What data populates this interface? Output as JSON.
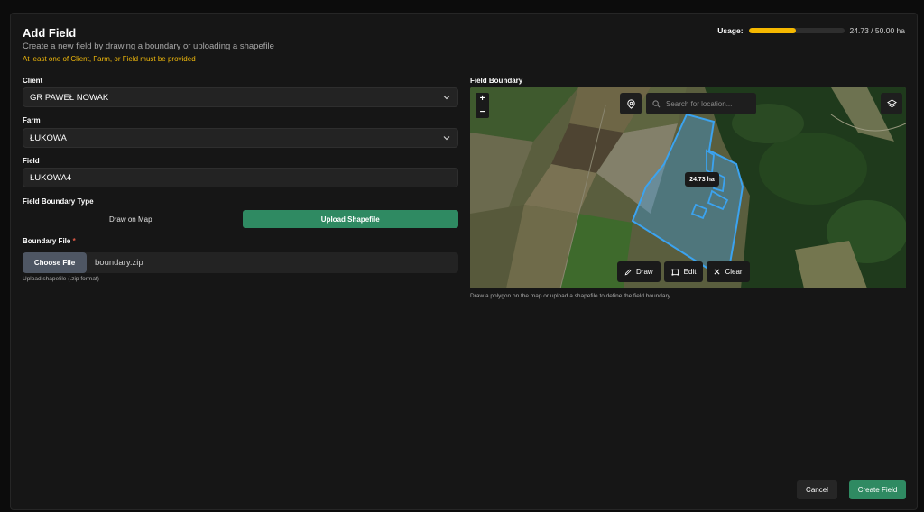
{
  "header": {
    "title": "Add Field",
    "subtitle": "Create a new field by drawing a boundary or uploading a shapefile",
    "warning": "At least one of Client, Farm, or Field must be provided"
  },
  "usage": {
    "label": "Usage:",
    "text": "24.73 / 50.00 ha",
    "fraction": 0.4946,
    "color": "#f5b800"
  },
  "form": {
    "client": {
      "label": "Client",
      "value": "GR PAWEŁ NOWAK"
    },
    "farm": {
      "label": "Farm",
      "value": "ŁUKOWA"
    },
    "field": {
      "label": "Field",
      "value": "ŁUKOWA4"
    },
    "boundary_type": {
      "label": "Field Boundary Type",
      "options": [
        "Draw on Map",
        "Upload Shapefile"
      ],
      "selected": "Upload Shapefile"
    },
    "boundary_file": {
      "label": "Boundary File",
      "required_mark": "*",
      "button": "Choose File",
      "file_name": "boundary.zip",
      "hint": "Upload shapefile (.zip format)"
    }
  },
  "map": {
    "label": "Field Boundary",
    "search_placeholder": "Search for location...",
    "zoom_in": "+",
    "zoom_out": "−",
    "area_badge": "24.73 ha",
    "tools": {
      "draw": "Draw",
      "edit": "Edit",
      "clear": "Clear"
    },
    "hint": "Draw a polygon on the map or upload a shapefile to define the field boundary",
    "boundary_color": "#3ba3f0"
  },
  "footer": {
    "cancel": "Cancel",
    "create": "Create Field"
  },
  "colors": {
    "accent": "#2f8a62",
    "warning": "#f0b90b"
  }
}
